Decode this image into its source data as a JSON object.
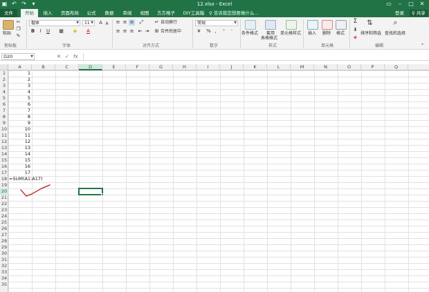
{
  "window": {
    "title": "12.xlsx - Excel"
  },
  "qat": {
    "save_icon": "save-icon",
    "undo_icon": "undo-icon",
    "redo_icon": "redo-icon",
    "customize_icon": "customize-icon"
  },
  "tabs": [
    {
      "label": "文件",
      "kind": "file"
    },
    {
      "label": "开始",
      "kind": "active"
    },
    {
      "label": "插入"
    },
    {
      "label": "页面布局"
    },
    {
      "label": "公式"
    },
    {
      "label": "数据"
    },
    {
      "label": "审阅"
    },
    {
      "label": "视图"
    },
    {
      "label": "方方格子"
    },
    {
      "label": "DIY工具箱"
    }
  ],
  "tell_me": "♀ 告诉我您想要做什么...",
  "account": {
    "sign_in": "登录",
    "share": "♀ 共享"
  },
  "ribbon": {
    "clipboard": {
      "paste": "粘贴",
      "label": "剪贴板"
    },
    "font": {
      "name": "楷体",
      "size": "11",
      "label": "字体",
      "bold": "B",
      "italic": "I",
      "underline": "U",
      "grow": "A",
      "shrink": "A",
      "font_color": "A"
    },
    "alignment": {
      "wrap": "自动换行",
      "merge": "合并后居中",
      "label": "对齐方式"
    },
    "number": {
      "format": "常规",
      "label": "数字",
      "percent": "%",
      "comma": ",",
      "currency": "¥"
    },
    "styles": {
      "conditional": "条件格式",
      "table_format_line1": "套用",
      "table_format_line2": "表格格式",
      "cell_styles": "单元格样式",
      "label": "样式"
    },
    "cells": {
      "insert": "插入",
      "delete": "删除",
      "format": "格式",
      "label": "单元格"
    },
    "editing": {
      "sort_filter": "排序和筛选",
      "find_select": "查找和选择",
      "label": "编辑"
    }
  },
  "formula_bar": {
    "name_box": "D20",
    "fx": "fx",
    "cancel": "✕",
    "enter": "✓",
    "content": ""
  },
  "sheet": {
    "columns": [
      "A",
      "B",
      "C",
      "D",
      "E",
      "F",
      "G",
      "H",
      "I",
      "J",
      "K",
      "L",
      "M",
      "N",
      "O",
      "P",
      "Q"
    ],
    "selected_column": "D",
    "selected_row": 20,
    "rows": [
      "1",
      "2",
      "3",
      "4",
      "5",
      "6",
      "7",
      "8",
      "9",
      "10",
      "11",
      "12",
      "13",
      "14",
      "15",
      "16",
      "17",
      "18",
      "19",
      "20",
      "21",
      "22",
      "23",
      "24",
      "25",
      "26",
      "27",
      "28",
      "29",
      "30",
      "31",
      "32",
      "33",
      "34",
      "35"
    ],
    "a_values": [
      "1",
      "2",
      "3",
      "4",
      "5",
      "6",
      "7",
      "8",
      "9",
      "10",
      "11",
      "12",
      "13",
      "14",
      "15",
      "16",
      "17"
    ],
    "a18_formula": "=SUM(A1:A17)"
  },
  "colors": {
    "accent": "#217346",
    "annotation": "#c0392b"
  }
}
